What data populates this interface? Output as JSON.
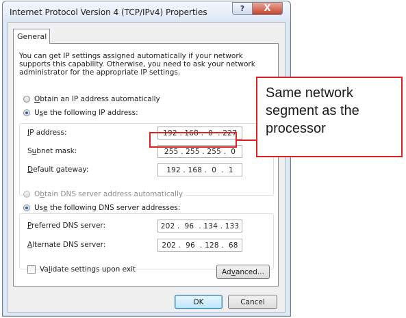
{
  "window": {
    "title": "Internet Protocol Version 4 (TCP/IPv4) Properties",
    "help_glyph": "?",
    "close_glyph": "X"
  },
  "tabs": [
    {
      "label": "General",
      "active": true
    }
  ],
  "description": "You can get IP settings assigned automatically if your network supports this capability. Otherwise, you need to ask your network administrator for the appropriate IP settings.",
  "ip_section": {
    "auto_option": {
      "prefix": "",
      "key": "O",
      "rest": "btain an IP address automatically",
      "selected": false
    },
    "manual_option": {
      "prefix": "U",
      "key": "s",
      "rest": "e the following IP address:",
      "selected": true
    },
    "fields": [
      {
        "prefix": "",
        "key": "I",
        "rest": "P address:",
        "value": "192 . 168 .  0  . 227"
      },
      {
        "prefix": "S",
        "key": "u",
        "rest": "bnet mask:",
        "value": "255 . 255 . 255 .  0"
      },
      {
        "prefix": "",
        "key": "D",
        "rest": "efault gateway:",
        "value": "192 . 168 .  0  .  1"
      }
    ]
  },
  "dns_section": {
    "auto_option": {
      "prefix": "O",
      "key": "b",
      "rest": "tain DNS server address automatically",
      "selected": false,
      "disabled": true
    },
    "manual_option": {
      "prefix": "Us",
      "key": "e",
      "rest": " the following DNS server addresses:",
      "selected": true
    },
    "fields": [
      {
        "prefix": "",
        "key": "P",
        "rest": "referred DNS server:",
        "value": "202 .  96  . 134 . 133"
      },
      {
        "prefix": "",
        "key": "A",
        "rest": "lternate DNS server:",
        "value": "202 .  96  . 128 .  68"
      }
    ]
  },
  "validate": {
    "prefix": "Va",
    "key": "l",
    "rest": "idate settings upon exit",
    "checked": false
  },
  "buttons": {
    "advanced": {
      "prefix": "Ad",
      "key": "v",
      "rest": "anced..."
    },
    "ok": "OK",
    "cancel": "Cancel"
  },
  "annotation": {
    "text": "Same network segment as the processor",
    "color": "#e02020"
  },
  "colors": {
    "selection_dot": "#2a63b8",
    "close_button": "#c5422a"
  }
}
